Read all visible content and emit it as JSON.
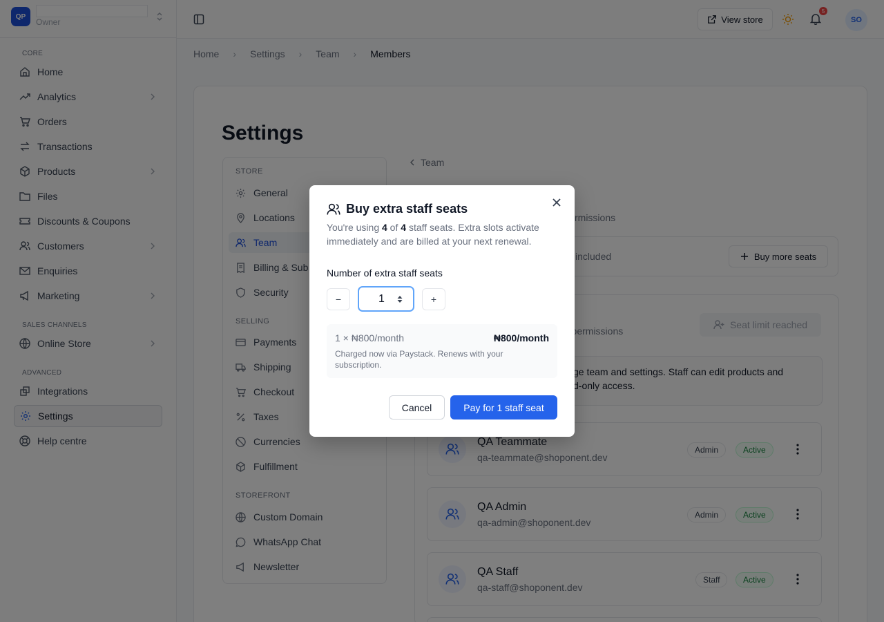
{
  "brand": {
    "logo": "QP",
    "role": "Owner"
  },
  "sidebar": {
    "sections": [
      "CORE",
      "SALES CHANNELS",
      "ADVANCED"
    ],
    "items": [
      {
        "label": "Home",
        "icon": "home-icon"
      },
      {
        "label": "Analytics",
        "icon": "trending-icon",
        "has_submenu": true
      },
      {
        "label": "Orders",
        "icon": "cart-icon"
      },
      {
        "label": "Transactions",
        "icon": "arrows-icon"
      },
      {
        "label": "Products",
        "icon": "box-icon",
        "has_submenu": true
      },
      {
        "label": "Files",
        "icon": "folder-icon"
      },
      {
        "label": "Discounts & Coupons",
        "icon": "ticket-icon"
      },
      {
        "label": "Customers",
        "icon": "users-icon",
        "has_submenu": true
      },
      {
        "label": "Enquiries",
        "icon": "mail-icon"
      },
      {
        "label": "Marketing",
        "icon": "megaphone-icon",
        "has_submenu": true
      },
      {
        "label": "Online Store",
        "icon": "globe-icon",
        "has_submenu": true
      },
      {
        "label": "Integrations",
        "icon": "puzzle-icon"
      },
      {
        "label": "Settings",
        "icon": "gear-icon",
        "active": true
      },
      {
        "label": "Help centre",
        "icon": "lifebuoy-icon"
      }
    ]
  },
  "topbar": {
    "view_store": "View store",
    "notifications": "5",
    "avatar": "SO"
  },
  "breadcrumb": [
    "Home",
    "Settings",
    "Team",
    "Members"
  ],
  "page": {
    "title": "Settings"
  },
  "settings_nav": {
    "sections": [
      "STORE",
      "SELLING",
      "STOREFRONT"
    ],
    "items": [
      {
        "label": "General",
        "icon": "gear-icon"
      },
      {
        "label": "Locations",
        "icon": "pin-icon"
      },
      {
        "label": "Team",
        "icon": "users-icon",
        "active": true
      },
      {
        "label": "Billing & Sub",
        "icon": "receipt-icon"
      },
      {
        "label": "Security",
        "icon": "shield-icon"
      },
      {
        "label": "Payments",
        "icon": "card-icon"
      },
      {
        "label": "Shipping",
        "icon": "truck-icon"
      },
      {
        "label": "Checkout",
        "icon": "cart-icon"
      },
      {
        "label": "Taxes",
        "icon": "percent-icon"
      },
      {
        "label": "Currencies",
        "icon": "coins-icon"
      },
      {
        "label": "Fulfillment",
        "icon": "package-icon"
      },
      {
        "label": "Custom Domain",
        "icon": "globe-icon"
      },
      {
        "label": "WhatsApp Chat",
        "icon": "chat-icon"
      },
      {
        "label": "Newsletter",
        "icon": "send-icon"
      }
    ]
  },
  "team_panel": {
    "back": "Team",
    "permissions_fragment": "rmissions",
    "seats_fragment": "included",
    "buy_more": "Buy more seats",
    "members_perm_fragment": "r permissions",
    "seat_limit": "Seat limit reached",
    "info_line1": "ge team and settings. Staff can edit products and",
    "info_line2": "d-only access."
  },
  "members": [
    {
      "name": "QA Teammate",
      "email": "qa-teammate@shoponent.dev",
      "role": "Admin",
      "status": "Active"
    },
    {
      "name": "QA Admin",
      "email": "qa-admin@shoponent.dev",
      "role": "Admin",
      "status": "Active"
    },
    {
      "name": "QA Staff",
      "email": "qa-staff@shoponent.dev",
      "role": "Staff",
      "status": "Active"
    }
  ],
  "modal": {
    "title": "Buy extra staff seats",
    "desc_a": "You're using ",
    "used": "4",
    "desc_of": " of ",
    "total": "4",
    "desc_b": " staff seats. Extra slots activate immediately and are billed at your next renewal.",
    "qty_label": "Number of extra staff seats",
    "minus": "−",
    "plus": "+",
    "qty_value": "1",
    "price_line": "1 × ₦800/month",
    "price_total": "₦800/month",
    "price_note": "Charged now via Paystack. Renews with your subscription.",
    "cancel": "Cancel",
    "pay": "Pay for 1 staff seat"
  },
  "colors": {
    "accent": "#2563eb",
    "overlay": "rgba(0,0,0,0.5)",
    "active_badge": "#15803d"
  }
}
